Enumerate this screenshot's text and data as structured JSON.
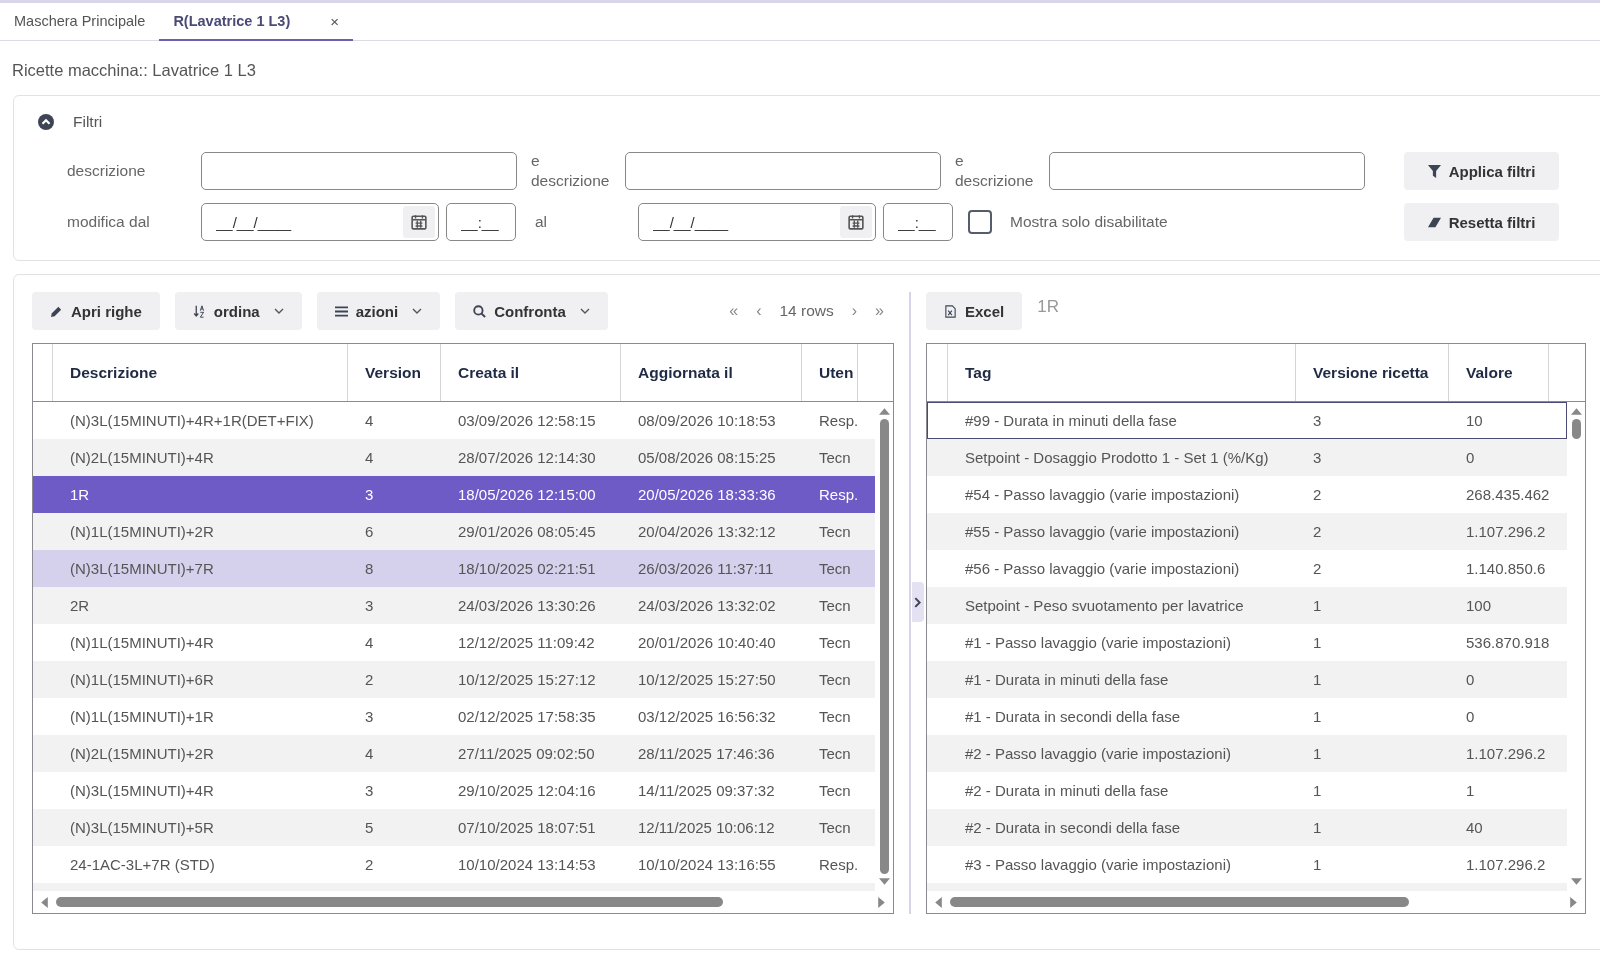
{
  "tabs": [
    {
      "label": "Maschera Principale",
      "selected": false
    },
    {
      "label": "R(Lavatrice 1 L3)",
      "selected": true,
      "close": "×"
    }
  ],
  "page_title": "Ricette macchina:: Lavatrice 1 L3",
  "filters": {
    "title": "Filtri",
    "expanded": true,
    "row_1": {
      "label": "descrizione",
      "and_label_1": "e descrizione",
      "and_label_2": "e descrizione"
    },
    "row_2": {
      "label": "modifica dal",
      "date_from": {
        "placeholder": "__/__/____"
      },
      "time_from": {
        "placeholder": "__:__"
      },
      "to_label": "al",
      "date_to": {
        "placeholder": "__/__/____"
      },
      "time_to": {
        "placeholder": "__:__"
      }
    },
    "only_disabled": {
      "label": "Mostra solo disabilitate",
      "checked": false
    },
    "apply_button": "Applica filtri",
    "reset_button": "Resetta filtri"
  },
  "toolbar": {
    "buttons": [
      {
        "label": "Apri righe",
        "kind": "edit",
        "dropdown": false
      },
      {
        "label": "ordina",
        "kind": "sort",
        "dropdown": true
      },
      {
        "label": "azioni",
        "kind": "menu",
        "dropdown": true
      },
      {
        "label": "Confronta",
        "kind": "search",
        "dropdown": true
      }
    ],
    "pager": {
      "first": "«",
      "prev": "‹",
      "label": "14 rows",
      "next": "›",
      "last": "»"
    }
  },
  "recipes": {
    "columns": [
      "Descrizione",
      "Version",
      "Creata il",
      "Aggiornata il",
      "Uten"
    ],
    "rows": [
      {
        "cells": [
          "(N)3L(15MINUTI)+4R+1R(DET+FIX)",
          "4",
          "03/09/2026 12:58:15",
          "08/09/2026 10:18:53",
          "Resp."
        ],
        "selected": false,
        "hovered": false
      },
      {
        "cells": [
          "(N)2L(15MINUTI)+4R",
          "4",
          "28/07/2026 12:14:30",
          "05/08/2026 08:15:25",
          "Tecn"
        ],
        "selected": false,
        "hovered": false
      },
      {
        "cells": [
          "1R",
          "3",
          "18/05/2026 12:15:00",
          "20/05/2026 18:33:36",
          "Resp."
        ],
        "selected": true,
        "hovered": false
      },
      {
        "cells": [
          "(N)1L(15MINUTI)+2R",
          "6",
          "29/01/2026 08:05:45",
          "20/04/2026 13:32:12",
          "Tecn"
        ],
        "selected": false,
        "hovered": false
      },
      {
        "cells": [
          "(N)3L(15MINUTI)+7R",
          "8",
          "18/10/2025 02:21:51",
          "26/03/2026 11:37:11",
          "Tecn"
        ],
        "selected": false,
        "hovered": true
      },
      {
        "cells": [
          "2R",
          "3",
          "24/03/2026 13:30:26",
          "24/03/2026 13:32:02",
          "Tecn"
        ],
        "selected": false,
        "hovered": false
      },
      {
        "cells": [
          "(N)1L(15MINUTI)+4R",
          "4",
          "12/12/2025 11:09:42",
          "20/01/2026 10:40:40",
          "Tecn"
        ],
        "selected": false,
        "hovered": false
      },
      {
        "cells": [
          "(N)1L(15MINUTI)+6R",
          "2",
          "10/12/2025 15:27:12",
          "10/12/2025 15:27:50",
          "Tecn"
        ],
        "selected": false,
        "hovered": false
      },
      {
        "cells": [
          "(N)1L(15MINUTI)+1R",
          "3",
          "02/12/2025 17:58:35",
          "03/12/2025 16:56:32",
          "Tecn"
        ],
        "selected": false,
        "hovered": false
      },
      {
        "cells": [
          "(N)2L(15MINUTI)+2R",
          "4",
          "27/11/2025 09:02:50",
          "28/11/2025 17:46:36",
          "Tecn"
        ],
        "selected": false,
        "hovered": false
      },
      {
        "cells": [
          "(N)3L(15MINUTI)+4R",
          "3",
          "29/10/2025 12:04:16",
          "14/11/2025 09:37:32",
          "Tecn"
        ],
        "selected": false,
        "hovered": false
      },
      {
        "cells": [
          "(N)3L(15MINUTI)+5R",
          "5",
          "07/10/2025 18:07:51",
          "12/11/2025 10:06:12",
          "Tecn"
        ],
        "selected": false,
        "hovered": false
      },
      {
        "cells": [
          "24-1AC-3L+7R (STD)",
          "2",
          "10/10/2024 13:14:53",
          "10/10/2024 13:16:55",
          "Resp."
        ],
        "selected": false,
        "hovered": false
      }
    ]
  },
  "details": {
    "excel_button": "Excel",
    "selection_label": "1R",
    "columns": [
      "Tag",
      "Versione ricetta",
      "Valore"
    ],
    "rows": [
      {
        "cells": [
          "#99 - Durata in minuti della fase",
          "3",
          "10"
        ],
        "focused": true
      },
      {
        "cells": [
          "Setpoint - Dosaggio Prodotto 1 - Set 1 (%/Kg)",
          "3",
          "0"
        ],
        "focused": false
      },
      {
        "cells": [
          "#54 - Passo lavaggio (varie impostazioni)",
          "2",
          "268.435.462"
        ],
        "focused": false
      },
      {
        "cells": [
          "#55 - Passo lavaggio (varie impostazioni)",
          "2",
          "1.107.296.2"
        ],
        "focused": false
      },
      {
        "cells": [
          "#56 - Passo lavaggio (varie impostazioni)",
          "2",
          "1.140.850.6"
        ],
        "focused": false
      },
      {
        "cells": [
          "Setpoint - Peso svuotamento per lavatrice",
          "1",
          "100"
        ],
        "focused": false
      },
      {
        "cells": [
          "#1 - Passo lavaggio (varie impostazioni)",
          "1",
          "536.870.918"
        ],
        "focused": false
      },
      {
        "cells": [
          "#1 - Durata in minuti della fase",
          "1",
          "0"
        ],
        "focused": false
      },
      {
        "cells": [
          "#1 - Durata in secondi della fase",
          "1",
          "0"
        ],
        "focused": false
      },
      {
        "cells": [
          "#2 - Passo lavaggio (varie impostazioni)",
          "1",
          "1.107.296.2"
        ],
        "focused": false
      },
      {
        "cells": [
          "#2 - Durata in minuti della fase",
          "1",
          "1"
        ],
        "focused": false
      },
      {
        "cells": [
          "#2 - Durata in secondi della fase",
          "1",
          "40"
        ],
        "focused": false
      },
      {
        "cells": [
          "#3 - Passo lavaggio (varie impostazioni)",
          "1",
          "1.107.296.2"
        ],
        "focused": false
      }
    ]
  }
}
